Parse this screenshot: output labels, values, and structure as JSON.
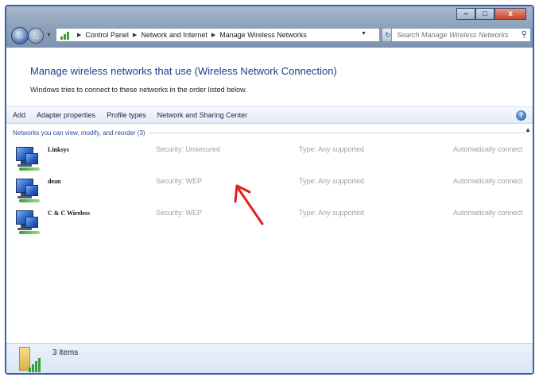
{
  "window": {
    "controls": {
      "minimize": "–",
      "maximize": "□",
      "close": "x"
    }
  },
  "address": {
    "breadcrumbs": [
      "Control Panel",
      "Network and Internet",
      "Manage Wireless Networks"
    ],
    "icon": "network-control-panel-icon"
  },
  "search": {
    "placeholder": "Search Manage Wireless Networks",
    "value": ""
  },
  "header": {
    "title": "Manage wireless networks that use (Wireless Network Connection)",
    "subtitle": "Windows tries to connect to these networks in the order listed below."
  },
  "toolbar": {
    "commands": [
      "Add",
      "Adapter properties",
      "Profile types",
      "Network and Sharing Center"
    ],
    "help_icon": "help-icon"
  },
  "networks": {
    "group_label": "Networks you can view, modify, and reorder (3)",
    "items": [
      {
        "name": "Linksys",
        "security": "Security: Unsecured",
        "type": "Type: Any supported",
        "mode": "Automatically connect"
      },
      {
        "name": "dean",
        "security": "Security: WEP",
        "type": "Type: Any supported",
        "mode": "Automatically connect"
      },
      {
        "name": "C & C Wireless",
        "security": "Security: WEP",
        "type": "Type: Any supported",
        "mode": "Automatically connect"
      }
    ]
  },
  "status": {
    "count": "3 items",
    "icon": "wireless-folder-icon"
  },
  "colors": {
    "title_blue": "#1e3e8a",
    "arrow_red": "#e0201b",
    "frame_blue": "#3b5fb0"
  }
}
